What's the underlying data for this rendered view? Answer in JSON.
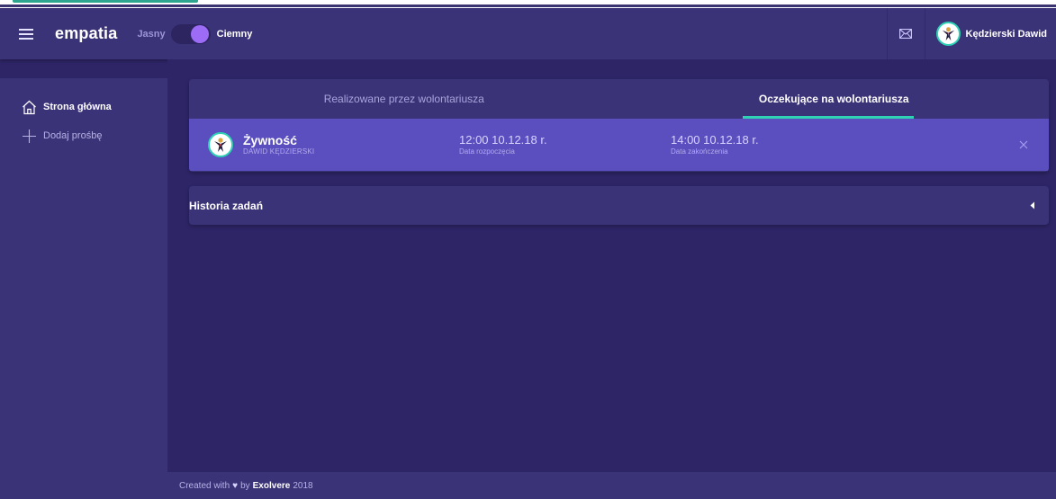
{
  "header": {
    "brand": "empatia",
    "theme_light_label": "Jasny",
    "theme_dark_label": "Ciemny",
    "user_name": "Kędzierski Dawid"
  },
  "sidebar": {
    "items": [
      {
        "label": "Strona główna",
        "icon": "home-icon"
      },
      {
        "label": "Dodaj prośbę",
        "icon": "plus-icon"
      }
    ]
  },
  "main": {
    "tabs": [
      {
        "label": "Realizowane przez wolontariusza",
        "active": false
      },
      {
        "label": "Oczekujące na wolontariusza",
        "active": true
      }
    ],
    "task": {
      "title": "Żywność",
      "author": "DAWID KĘDZIERSKI",
      "start_value": "12:00 10.12.18 r.",
      "start_label": "Data rozpoczęcia",
      "end_value": "14:00 10.12.18 r.",
      "end_label": "Data zakończenia"
    },
    "history_label": "Historia zadań"
  },
  "footer": {
    "prefix": "Created with",
    "heart": "♥",
    "by": "by",
    "brand": "Exolvere",
    "year": "2018"
  },
  "colors": {
    "background": "#2d2566",
    "header": "#3b3378",
    "accent": "#2fd1b5",
    "toggle": "#9d6cf6",
    "task_row": "#5b4fc0"
  }
}
